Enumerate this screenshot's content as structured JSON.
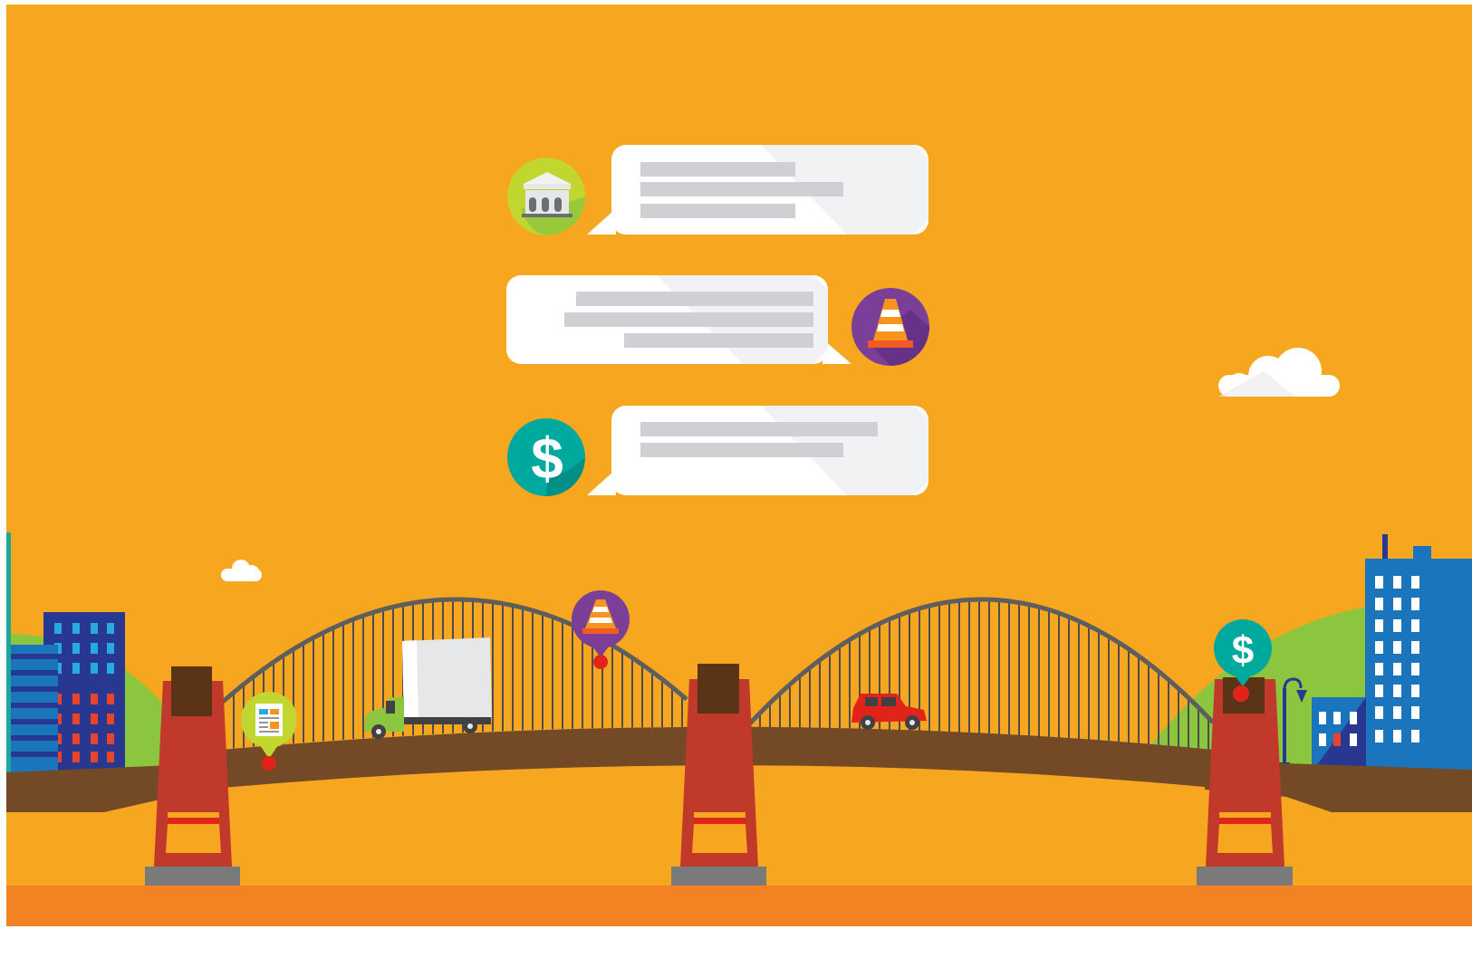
{
  "illustration": {
    "colors": {
      "sky": "#F7A61F",
      "ground": "#F38222",
      "bridge_deck": "#744A26",
      "arch": "#5E5E5E",
      "tower": "#C0392B",
      "tower_cap": "#5B3416",
      "tower_base": "#7A7A7A",
      "hill": "#8CC63F",
      "bubble": "#FFFFFF",
      "bubble_shade": "#F1F2F4",
      "text_line": "#CFD0D3",
      "bank_badge": "#C2D630",
      "cone_badge": "#7B3F98",
      "dollar_badge": "#00A99D",
      "building_blue": "#1B75BC",
      "building_navy": "#283891",
      "window_cyan": "#27AAE1",
      "window_red": "#E8432C",
      "car": "#E2231A",
      "truck": "#8CC63F"
    },
    "messages": [
      {
        "icon": "bank-icon",
        "side": "left",
        "lines": 3
      },
      {
        "icon": "traffic-cone-icon",
        "side": "right",
        "lines": 3
      },
      {
        "icon": "dollar-icon",
        "side": "left",
        "lines": 2
      }
    ],
    "map_pins": [
      "document-icon",
      "traffic-cone-icon",
      "dollar-icon"
    ],
    "vehicles": [
      "delivery-truck",
      "red-car"
    ]
  }
}
